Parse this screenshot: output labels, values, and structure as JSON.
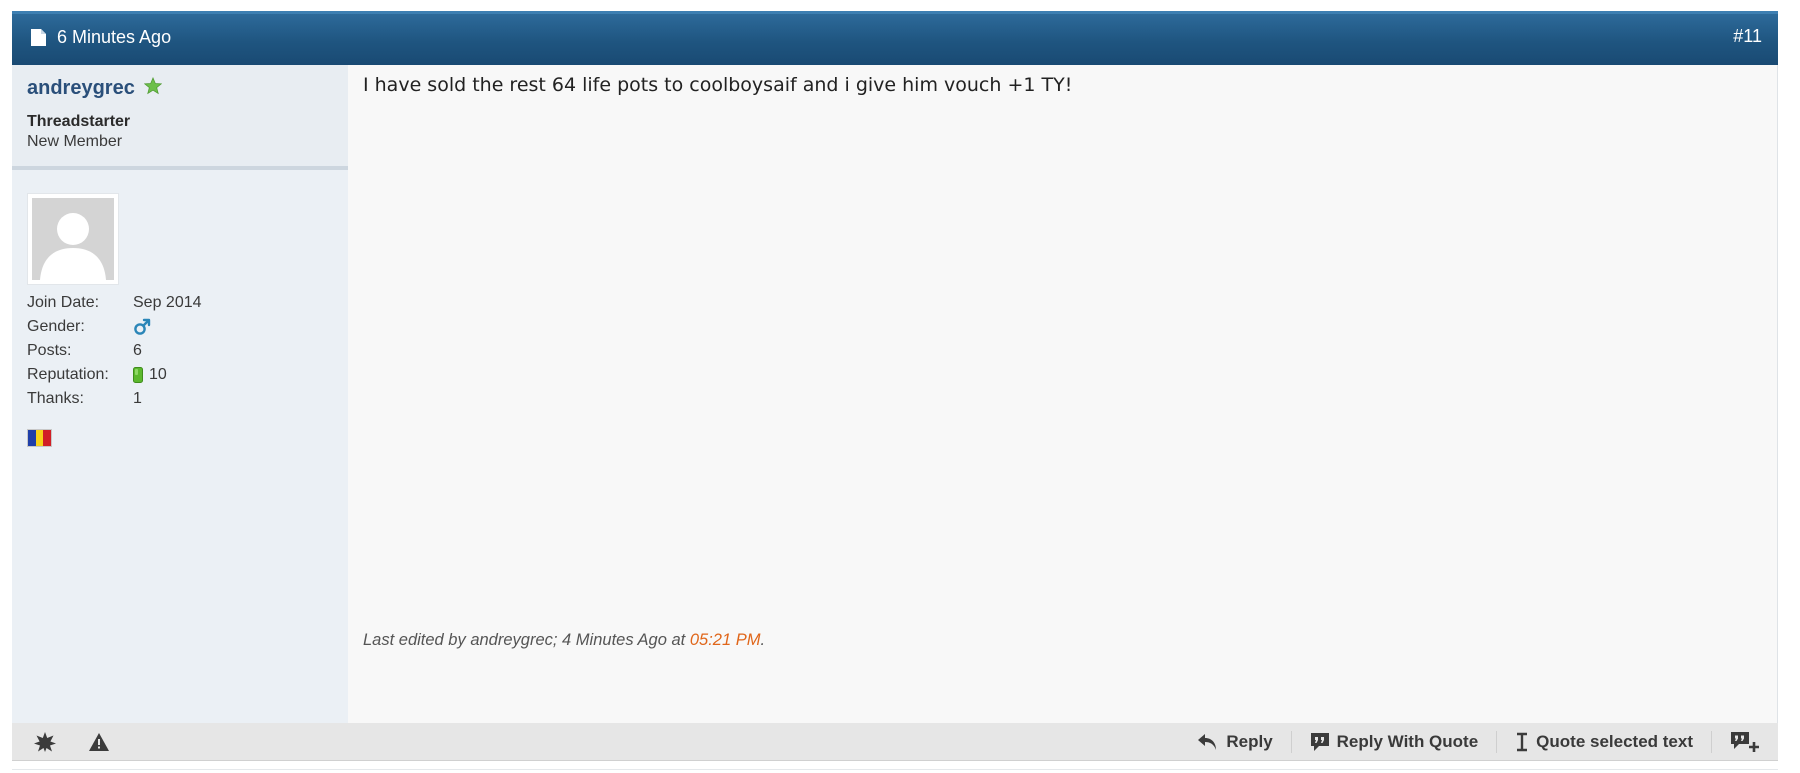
{
  "post": {
    "date_text": "6 Minutes Ago",
    "number": "#11",
    "doc_icon": "document-icon"
  },
  "user": {
    "username": "andreygrec",
    "online_icon": "online-star-icon",
    "title": "Threadstarter",
    "rank": "New Member",
    "stats": [
      {
        "label": "Join Date:",
        "value": "Sep 2014"
      },
      {
        "label": "Gender:",
        "value": "",
        "icon": "male-gender-icon"
      },
      {
        "label": "Posts:",
        "value": "6"
      },
      {
        "label": "Reputation:",
        "value": "10",
        "icon": "reputation-bar-icon"
      },
      {
        "label": "Thanks:",
        "value": "1"
      }
    ],
    "flag_icon": "country-flag-icon"
  },
  "content": {
    "text": "I have sold the rest 64 life pots to coolboysaif and i give him vouch +1 TY!",
    "edit_prefix": "Last edited by andreygrec; 4 Minutes Ago at ",
    "edit_time": "05:21 PM",
    "edit_suffix": "."
  },
  "footer": {
    "left_icons": [
      "star-icon",
      "report-warning-icon"
    ],
    "actions": [
      {
        "label": "Reply",
        "icon": "reply-arrow-icon"
      },
      {
        "label": "Reply With Quote",
        "icon": "quote-bubble-icon"
      },
      {
        "label": "Quote selected text",
        "icon": "text-cursor-icon"
      },
      {
        "label": "",
        "icon": "multi-quote-icon"
      }
    ]
  },
  "colors": {
    "header_blue": "#1f5580",
    "username_blue": "#2a4f7a",
    "edit_time_orange": "#e0661a",
    "reputation_green": "#5cb82e"
  }
}
